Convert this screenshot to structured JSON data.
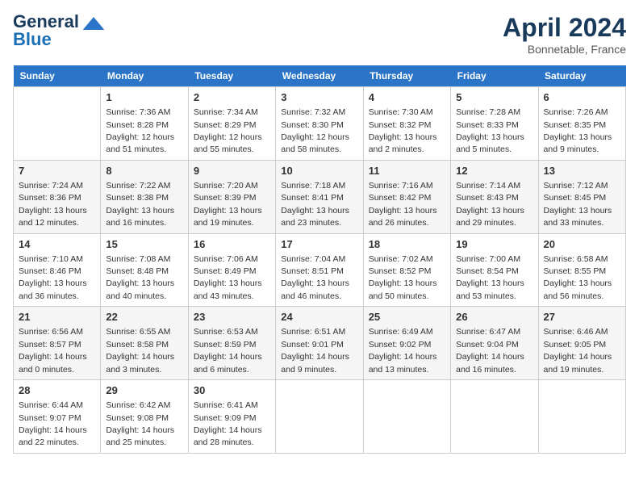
{
  "header": {
    "logo_line1": "General",
    "logo_line2": "Blue",
    "month": "April 2024",
    "location": "Bonnetable, France"
  },
  "weekdays": [
    "Sunday",
    "Monday",
    "Tuesday",
    "Wednesday",
    "Thursday",
    "Friday",
    "Saturday"
  ],
  "weeks": [
    [
      {
        "day": "",
        "empty": true
      },
      {
        "day": "1",
        "sunrise": "7:36 AM",
        "sunset": "8:28 PM",
        "daylight": "12 hours and 51 minutes."
      },
      {
        "day": "2",
        "sunrise": "7:34 AM",
        "sunset": "8:29 PM",
        "daylight": "12 hours and 55 minutes."
      },
      {
        "day": "3",
        "sunrise": "7:32 AM",
        "sunset": "8:30 PM",
        "daylight": "12 hours and 58 minutes."
      },
      {
        "day": "4",
        "sunrise": "7:30 AM",
        "sunset": "8:32 PM",
        "daylight": "13 hours and 2 minutes."
      },
      {
        "day": "5",
        "sunrise": "7:28 AM",
        "sunset": "8:33 PM",
        "daylight": "13 hours and 5 minutes."
      },
      {
        "day": "6",
        "sunrise": "7:26 AM",
        "sunset": "8:35 PM",
        "daylight": "13 hours and 9 minutes."
      }
    ],
    [
      {
        "day": "7",
        "sunrise": "7:24 AM",
        "sunset": "8:36 PM",
        "daylight": "13 hours and 12 minutes."
      },
      {
        "day": "8",
        "sunrise": "7:22 AM",
        "sunset": "8:38 PM",
        "daylight": "13 hours and 16 minutes."
      },
      {
        "day": "9",
        "sunrise": "7:20 AM",
        "sunset": "8:39 PM",
        "daylight": "13 hours and 19 minutes."
      },
      {
        "day": "10",
        "sunrise": "7:18 AM",
        "sunset": "8:41 PM",
        "daylight": "13 hours and 23 minutes."
      },
      {
        "day": "11",
        "sunrise": "7:16 AM",
        "sunset": "8:42 PM",
        "daylight": "13 hours and 26 minutes."
      },
      {
        "day": "12",
        "sunrise": "7:14 AM",
        "sunset": "8:43 PM",
        "daylight": "13 hours and 29 minutes."
      },
      {
        "day": "13",
        "sunrise": "7:12 AM",
        "sunset": "8:45 PM",
        "daylight": "13 hours and 33 minutes."
      }
    ],
    [
      {
        "day": "14",
        "sunrise": "7:10 AM",
        "sunset": "8:46 PM",
        "daylight": "13 hours and 36 minutes."
      },
      {
        "day": "15",
        "sunrise": "7:08 AM",
        "sunset": "8:48 PM",
        "daylight": "13 hours and 40 minutes."
      },
      {
        "day": "16",
        "sunrise": "7:06 AM",
        "sunset": "8:49 PM",
        "daylight": "13 hours and 43 minutes."
      },
      {
        "day": "17",
        "sunrise": "7:04 AM",
        "sunset": "8:51 PM",
        "daylight": "13 hours and 46 minutes."
      },
      {
        "day": "18",
        "sunrise": "7:02 AM",
        "sunset": "8:52 PM",
        "daylight": "13 hours and 50 minutes."
      },
      {
        "day": "19",
        "sunrise": "7:00 AM",
        "sunset": "8:54 PM",
        "daylight": "13 hours and 53 minutes."
      },
      {
        "day": "20",
        "sunrise": "6:58 AM",
        "sunset": "8:55 PM",
        "daylight": "13 hours and 56 minutes."
      }
    ],
    [
      {
        "day": "21",
        "sunrise": "6:56 AM",
        "sunset": "8:57 PM",
        "daylight": "14 hours and 0 minutes."
      },
      {
        "day": "22",
        "sunrise": "6:55 AM",
        "sunset": "8:58 PM",
        "daylight": "14 hours and 3 minutes."
      },
      {
        "day": "23",
        "sunrise": "6:53 AM",
        "sunset": "8:59 PM",
        "daylight": "14 hours and 6 minutes."
      },
      {
        "day": "24",
        "sunrise": "6:51 AM",
        "sunset": "9:01 PM",
        "daylight": "14 hours and 9 minutes."
      },
      {
        "day": "25",
        "sunrise": "6:49 AM",
        "sunset": "9:02 PM",
        "daylight": "14 hours and 13 minutes."
      },
      {
        "day": "26",
        "sunrise": "6:47 AM",
        "sunset": "9:04 PM",
        "daylight": "14 hours and 16 minutes."
      },
      {
        "day": "27",
        "sunrise": "6:46 AM",
        "sunset": "9:05 PM",
        "daylight": "14 hours and 19 minutes."
      }
    ],
    [
      {
        "day": "28",
        "sunrise": "6:44 AM",
        "sunset": "9:07 PM",
        "daylight": "14 hours and 22 minutes."
      },
      {
        "day": "29",
        "sunrise": "6:42 AM",
        "sunset": "9:08 PM",
        "daylight": "14 hours and 25 minutes."
      },
      {
        "day": "30",
        "sunrise": "6:41 AM",
        "sunset": "9:09 PM",
        "daylight": "14 hours and 28 minutes."
      },
      {
        "day": "",
        "empty": true
      },
      {
        "day": "",
        "empty": true
      },
      {
        "day": "",
        "empty": true
      },
      {
        "day": "",
        "empty": true
      }
    ]
  ]
}
